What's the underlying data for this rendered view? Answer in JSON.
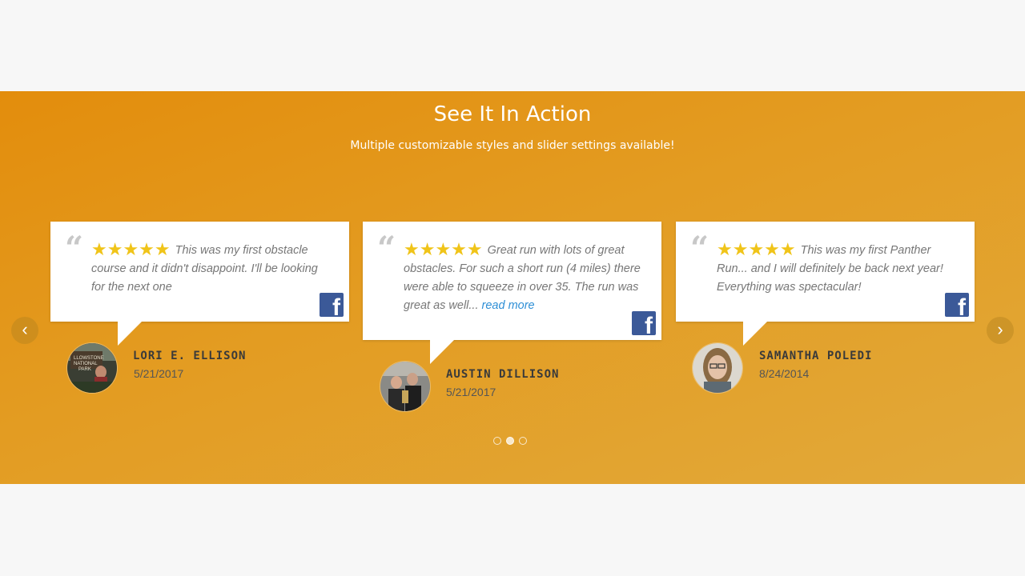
{
  "header": {
    "title": "See It In Action",
    "subtitle": "Multiple customizable styles and slider settings available!"
  },
  "colors": {
    "band_start": "#e38d0c",
    "band_end": "#e2a93a",
    "stars": "#f0c419",
    "facebook": "#3b5998",
    "read_more": "#2e8fd6"
  },
  "reviews": [
    {
      "stars": "★★★★★",
      "rating": 5,
      "text": "This was my first obstacle course and it didn't disappoint. I'll be looking for the next one",
      "read_more": "",
      "source_icon": "facebook-icon",
      "name": "LORI E. ELLISON",
      "date": "5/21/2017"
    },
    {
      "stars": "★★★★★",
      "rating": 5,
      "text": "Great run with lots of great obstacles. For such a short run (4 miles) there were able to squeeze in over 35. The run was great as well...",
      "read_more": "read more",
      "source_icon": "facebook-icon",
      "name": "AUSTIN DILLISON",
      "date": "5/21/2017"
    },
    {
      "stars": "★★★★★",
      "rating": 5,
      "text": "This was my first Panther Run... and I will definitely be back next year! Everything was spectacular!",
      "read_more": "",
      "source_icon": "facebook-icon",
      "name": "SAMANTHA POLEDI",
      "date": "8/24/2014"
    }
  ],
  "slider": {
    "prev_icon": "‹",
    "next_icon": "›",
    "dot_count": 3,
    "active_dot": 2
  }
}
